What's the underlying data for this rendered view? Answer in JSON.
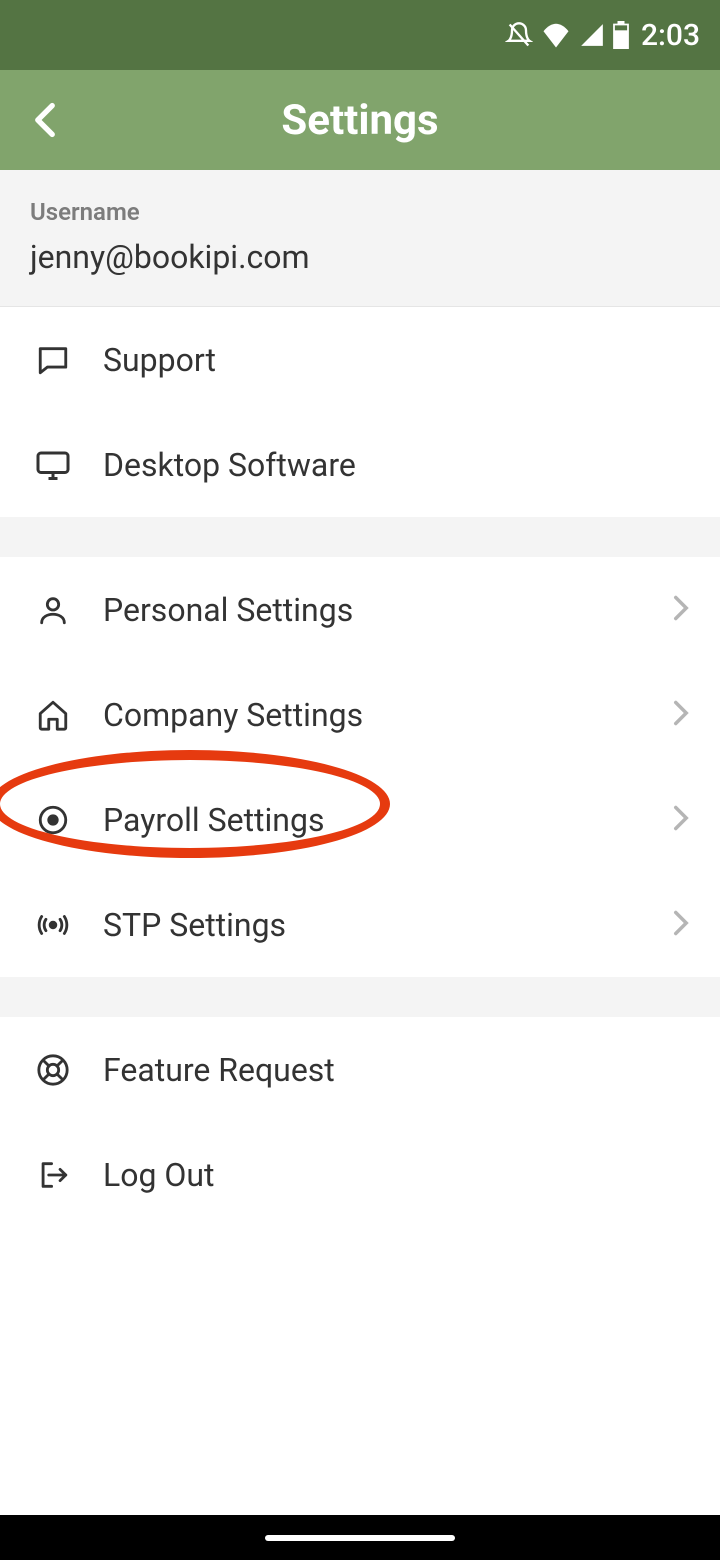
{
  "status": {
    "time": "2:03"
  },
  "header": {
    "title": "Settings"
  },
  "user": {
    "label": "Username",
    "email": "jenny@bookipi.com"
  },
  "rows": {
    "support": "Support",
    "desktop": "Desktop Software",
    "personal": "Personal Settings",
    "company": "Company Settings",
    "payroll": "Payroll Settings",
    "stp": "STP Settings",
    "feature": "Feature Request",
    "logout": "Log Out"
  },
  "annotation": {
    "highlighted_row": "payroll"
  }
}
